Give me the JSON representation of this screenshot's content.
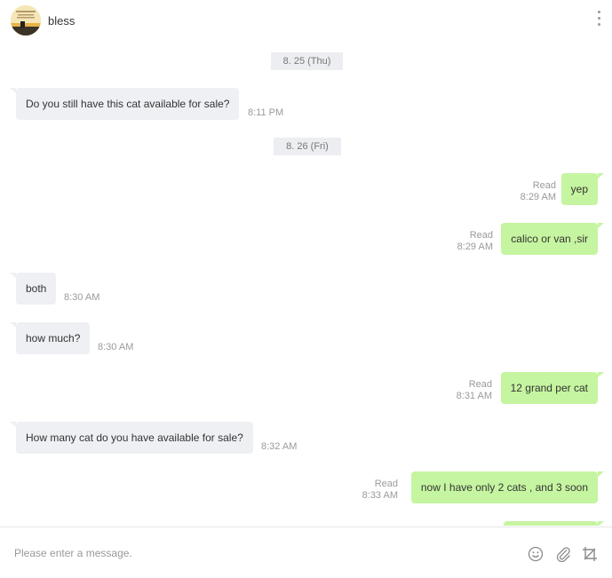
{
  "header": {
    "contact_name": "bless"
  },
  "chat": {
    "dates": [
      {
        "label": "8. 25 (Thu)"
      },
      {
        "label": "8. 26 (Fri)"
      }
    ],
    "messages": [
      {
        "direction": "in",
        "text": "Do you still have this cat available for sale?",
        "time": "8:11 PM"
      },
      {
        "direction": "out",
        "text": "yep",
        "status": "Read",
        "time": "8:29 AM"
      },
      {
        "direction": "out",
        "text": "calico or van ,sir",
        "status": "Read",
        "time": "8:29 AM"
      },
      {
        "direction": "in",
        "text": "both",
        "time": "8:30 AM"
      },
      {
        "direction": "in",
        "text": "how much?",
        "time": "8:30 AM"
      },
      {
        "direction": "out",
        "text": "12 grand per cat",
        "status": "Read",
        "time": "8:31 AM"
      },
      {
        "direction": "in",
        "text": "How many cat do you have available for sale?",
        "time": "8:32 AM"
      },
      {
        "direction": "out",
        "text": "now I have only 2 cats , and 3 soon",
        "status": "Read",
        "time": "8:33 AM"
      }
    ]
  },
  "composer": {
    "placeholder": "Please enter a message.",
    "value": "",
    "icons": [
      "emoji-icon",
      "attachment-icon",
      "crop-icon"
    ]
  },
  "colors": {
    "incoming_bubble": "#eef0f4",
    "outgoing_bubble": "#c5f5a0",
    "date_divider": "#eceef1"
  }
}
